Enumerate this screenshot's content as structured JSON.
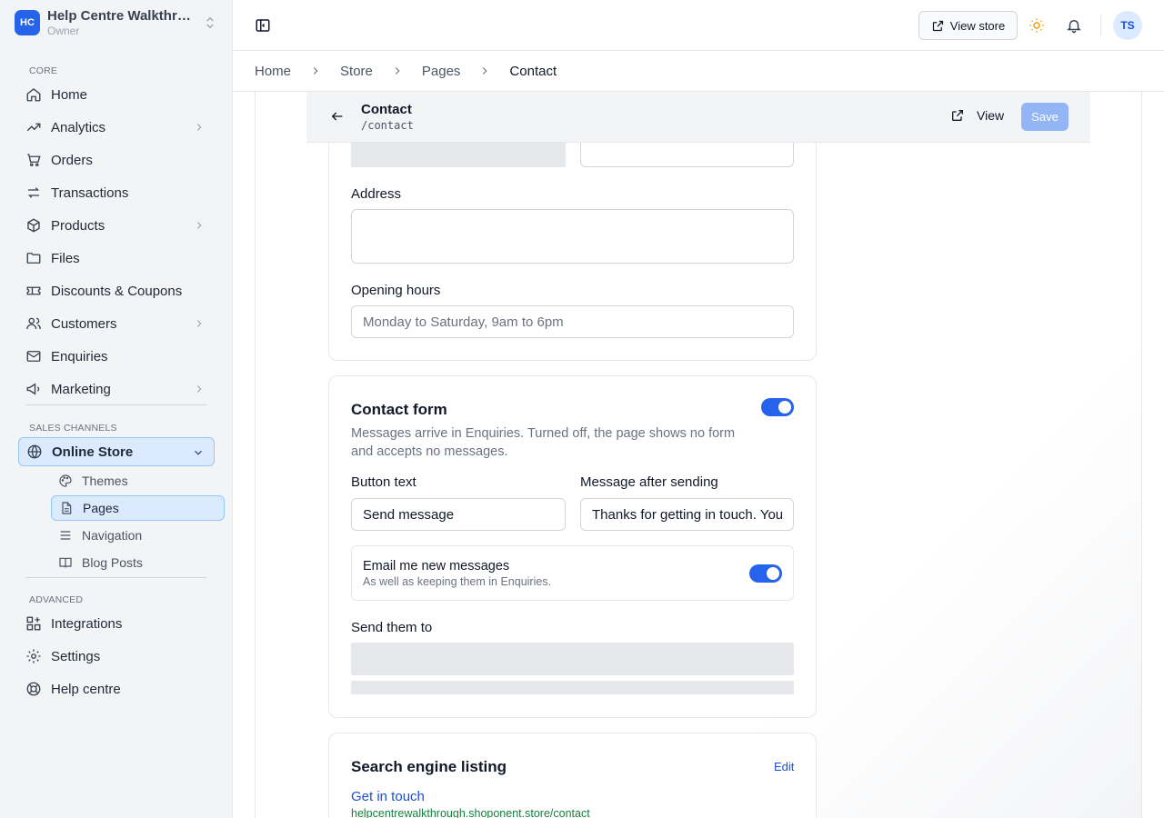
{
  "workspace": {
    "initials": "HC",
    "name": "Help Centre Walkthrough",
    "role": "Owner"
  },
  "sidebar": {
    "core_label": "CORE",
    "core_items": [
      {
        "label": "Home",
        "icon": "home-icon"
      },
      {
        "label": "Analytics",
        "icon": "trending-icon"
      },
      {
        "label": "Orders",
        "icon": "cart-icon"
      },
      {
        "label": "Transactions",
        "icon": "arrows-icon"
      },
      {
        "label": "Products",
        "icon": "box-icon"
      },
      {
        "label": "Files",
        "icon": "folder-icon"
      },
      {
        "label": "Discounts & Coupons",
        "icon": "ticket-icon"
      },
      {
        "label": "Customers",
        "icon": "users-icon"
      },
      {
        "label": "Enquiries",
        "icon": "mail-icon"
      },
      {
        "label": "Marketing",
        "icon": "megaphone-icon"
      }
    ],
    "sales_label": "SALES CHANNELS",
    "online_store": "Online Store",
    "store_sub": [
      {
        "label": "Themes",
        "icon": "palette-icon"
      },
      {
        "label": "Pages",
        "icon": "page-icon"
      },
      {
        "label": "Navigation",
        "icon": "menu-icon"
      },
      {
        "label": "Blog Posts",
        "icon": "book-icon"
      }
    ],
    "advanced_label": "ADVANCED",
    "advanced_items": [
      {
        "label": "Integrations",
        "icon": "grid-plus-icon"
      },
      {
        "label": "Settings",
        "icon": "gear-icon"
      },
      {
        "label": "Help centre",
        "icon": "lifebuoy-icon"
      }
    ]
  },
  "topbar": {
    "view_store": "View store",
    "avatar": "TS"
  },
  "breadcrumb": [
    "Home",
    "Store",
    "Pages",
    "Contact"
  ],
  "page": {
    "title": "Contact",
    "slug": "/contact",
    "view": "View",
    "save": "Save"
  },
  "details": {
    "address_label": "Address",
    "hours_label": "Opening hours",
    "hours_placeholder": "Monday to Saturday, 9am to 6pm"
  },
  "contact_form": {
    "title": "Contact form",
    "description": "Messages arrive in Enquiries. Turned off, the page shows no form and accepts no messages.",
    "enabled": true,
    "button_text_label": "Button text",
    "button_text_value": "Send message",
    "after_label": "Message after sending",
    "after_value": "Thanks for getting in touch. You",
    "email_title": "Email me new messages",
    "email_sub": "As well as keeping them in Enquiries.",
    "email_enabled": true,
    "send_to_label": "Send them to"
  },
  "seo": {
    "title": "Search engine listing",
    "edit": "Edit",
    "link_title": "Get in touch",
    "url": "helpcentrewalkthrough.shoponent.store/contact"
  },
  "colors": {
    "accent": "#2563eb",
    "save_disabled": "#93b4f5",
    "sun": "#f59e0b"
  }
}
